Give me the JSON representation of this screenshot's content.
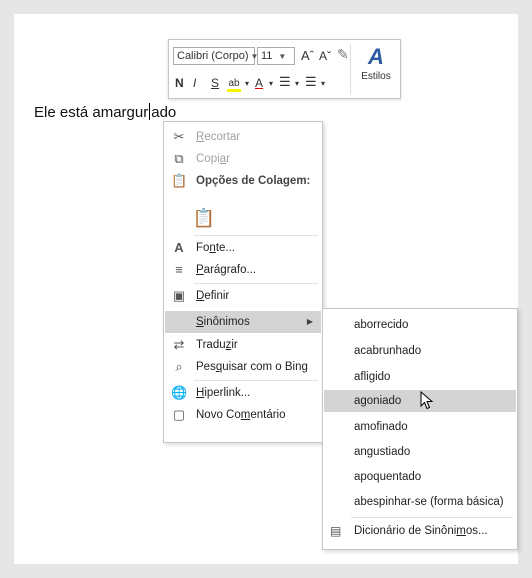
{
  "document": {
    "text_before_cursor": "Ele está amargur",
    "text_after_cursor": "ado"
  },
  "mini_toolbar": {
    "font_name": "Calibri (Corpo)",
    "font_size": "11",
    "grow_font": "Aˆ",
    "shrink_font": "Aˇ",
    "bold": "N",
    "italic": "I",
    "underline": "S",
    "font_color": "A",
    "styles_label": "Estilos"
  },
  "context_menu": {
    "items": [
      {
        "pre": "",
        "u": "R",
        "post": "ecortar",
        "icon": "scissors-icon"
      },
      {
        "pre": "Copi",
        "u": "a",
        "post": "r",
        "icon": "copy-icon"
      },
      {
        "label": "Opções de Colagem:",
        "icon": "clipboard-icon"
      },
      {
        "pre": "Fo",
        "u": "n",
        "post": "te...",
        "icon": "font-icon"
      },
      {
        "pre": "",
        "u": "P",
        "post": "arágrafo...",
        "icon": "paragraph-icon"
      },
      {
        "pre": "",
        "u": "D",
        "post": "efinir",
        "icon": "define-icon"
      },
      {
        "pre": "",
        "u": "S",
        "post": "inônimos",
        "icon": "synonyms-icon"
      },
      {
        "pre": "Tradu",
        "u": "z",
        "post": "ir",
        "icon": "translate-icon"
      },
      {
        "pre": "Pes",
        "u": "q",
        "post": "uisar com o Bing",
        "icon": "search-icon"
      },
      {
        "pre": "",
        "u": "H",
        "post": "iperlink...",
        "icon": "hyperlink-icon"
      },
      {
        "pre": "Novo Co",
        "u": "m",
        "post": "entário",
        "icon": "comment-icon"
      }
    ]
  },
  "synonyms_submenu": {
    "items": [
      "aborrecido",
      "acabrunhado",
      "afligido",
      "agoniado",
      "amofinado",
      "angustiado",
      "apoquentado",
      "abespinhar-se (forma básica)"
    ],
    "highlighted": "agoniado",
    "thesaurus": {
      "pre": "Dicionário de Sinôni",
      "u": "m",
      "post": "os..."
    }
  }
}
